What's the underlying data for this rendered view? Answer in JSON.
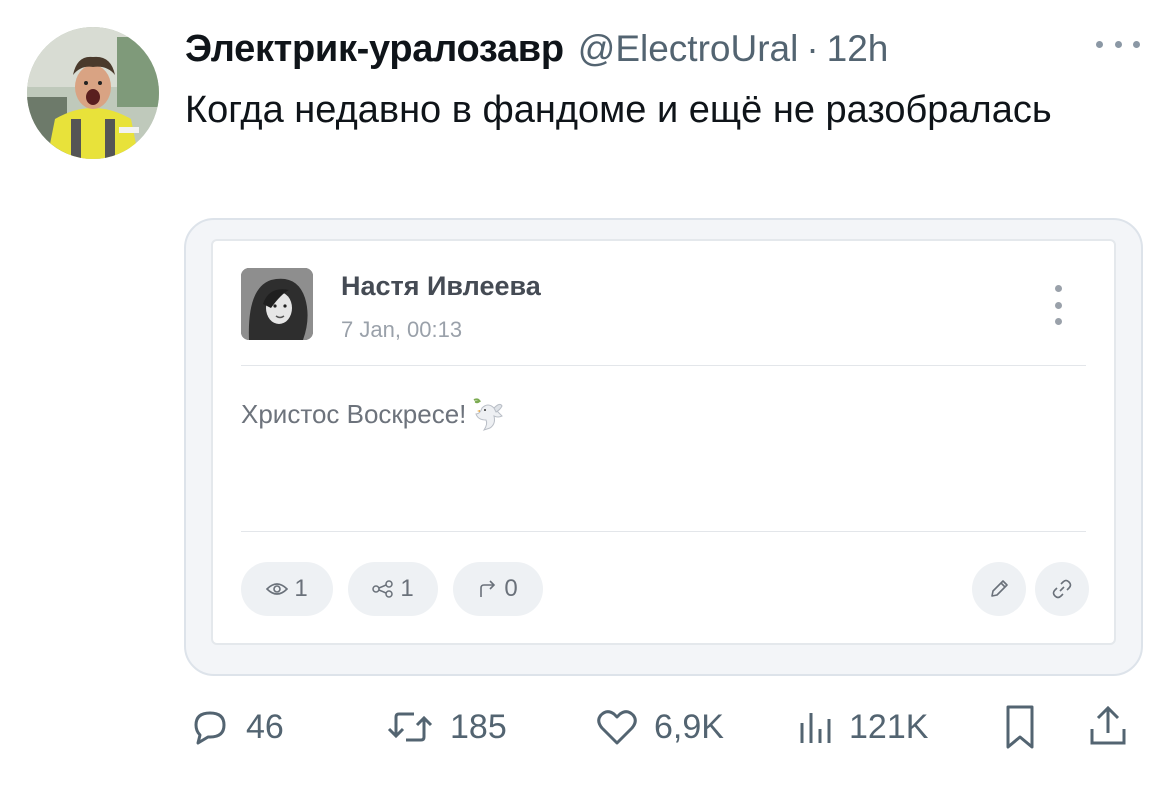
{
  "tweet": {
    "display_name": "Электрик-уралозавр",
    "handle": "@ElectroUral",
    "separator": "·",
    "time": "12h",
    "text": "Когда недавно в фандоме и ещё не разобралась",
    "avatar_icon": "user-avatar-photo",
    "more_icon": "more-horizontal-icon"
  },
  "embed": {
    "author": "Настя Ивлеева",
    "date": "7 Jan, 00:13",
    "text": "Христос Воскресе!",
    "emoji_icon": "dove-icon",
    "stats": {
      "views": "1",
      "shares": "1",
      "forwards": "0"
    },
    "icons": [
      "eye-icon",
      "share-nodes-icon",
      "forward-arrow-icon",
      "pencil-icon",
      "link-icon",
      "vertical-dots-icon"
    ]
  },
  "actions": {
    "replies": "46",
    "retweets": "185",
    "likes": "6,9K",
    "views": "121K"
  },
  "colors": {
    "text": "#0f1419",
    "secondary": "#536471",
    "card_border": "#dde3ea",
    "pill_bg": "#eef1f4"
  }
}
